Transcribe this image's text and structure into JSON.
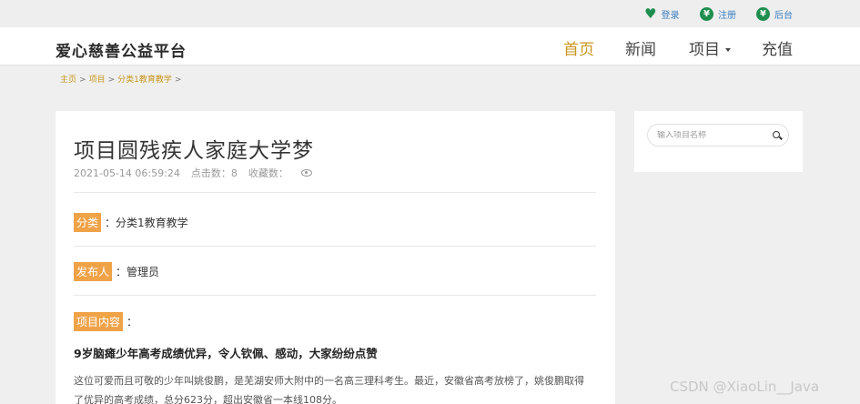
{
  "top": {
    "login": "登录",
    "register": "注册",
    "admin": "后台",
    "register_icon_glyph": "¥",
    "admin_icon_glyph": "¥"
  },
  "nav": {
    "brand": "爱心慈善公益平台",
    "items": [
      "首页",
      "新闻",
      "项目",
      "充值"
    ],
    "active": "首页"
  },
  "breadcrumb": {
    "items": [
      "主页",
      "项目",
      "分类1教育教学"
    ],
    "separator": ">"
  },
  "article": {
    "title": "项目圆残疾人家庭大学梦",
    "datetime": "2021-05-14 06:59:24",
    "clicks_label": "点击数：",
    "clicks": "8",
    "favorites_label": "收藏数：",
    "category_label": "分类",
    "category_value": "分类1教育教学",
    "publisher_label": "发布人",
    "publisher_value": "管理员",
    "content_label": "项目内容",
    "colon": "：",
    "subheading": "9岁脑瘫少年高考成绩优异，令人钦佩、感动，大家纷纷点赞",
    "paragraph_line1": "这位可爱而且可敬的少年叫姚俊鹏，是芜湖安师大附中的一名高三理科考生。最近，安徽省高考放榜了，姚俊鹏取得",
    "paragraph_line2": "了优异的高考成绩，总分623分，超出安徽省一本线108分。"
  },
  "sidebar": {
    "search_placeholder": "输入项目名称"
  },
  "watermark": "CSDN @XiaoLin__Java",
  "colors": {
    "accent": "#c9961c",
    "tag": "#f0a247",
    "icon_green": "#1e8e4e",
    "link_blue": "#3a7fc2"
  }
}
